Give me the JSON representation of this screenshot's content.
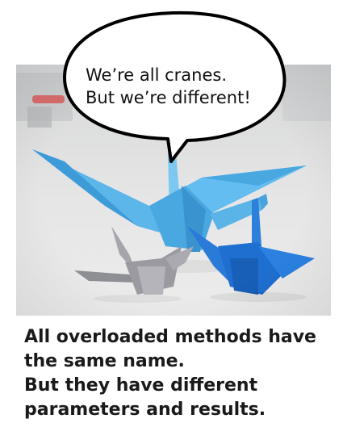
{
  "speech_bubble": {
    "lines": [
      "We’re all cranes.",
      "But we’re different!"
    ]
  },
  "caption": {
    "lines": [
      "All overloaded methods have",
      "the same name.",
      "But they have different",
      "parameters and results."
    ]
  },
  "colors": {
    "large_crane": "#4aa8e0",
    "medium_crane": "#1f6fd0",
    "small_crane": "#9a9aa0",
    "caption_text": "#1a1a1a"
  },
  "icons": [
    "large-crane",
    "medium-crane",
    "small-crane"
  ]
}
